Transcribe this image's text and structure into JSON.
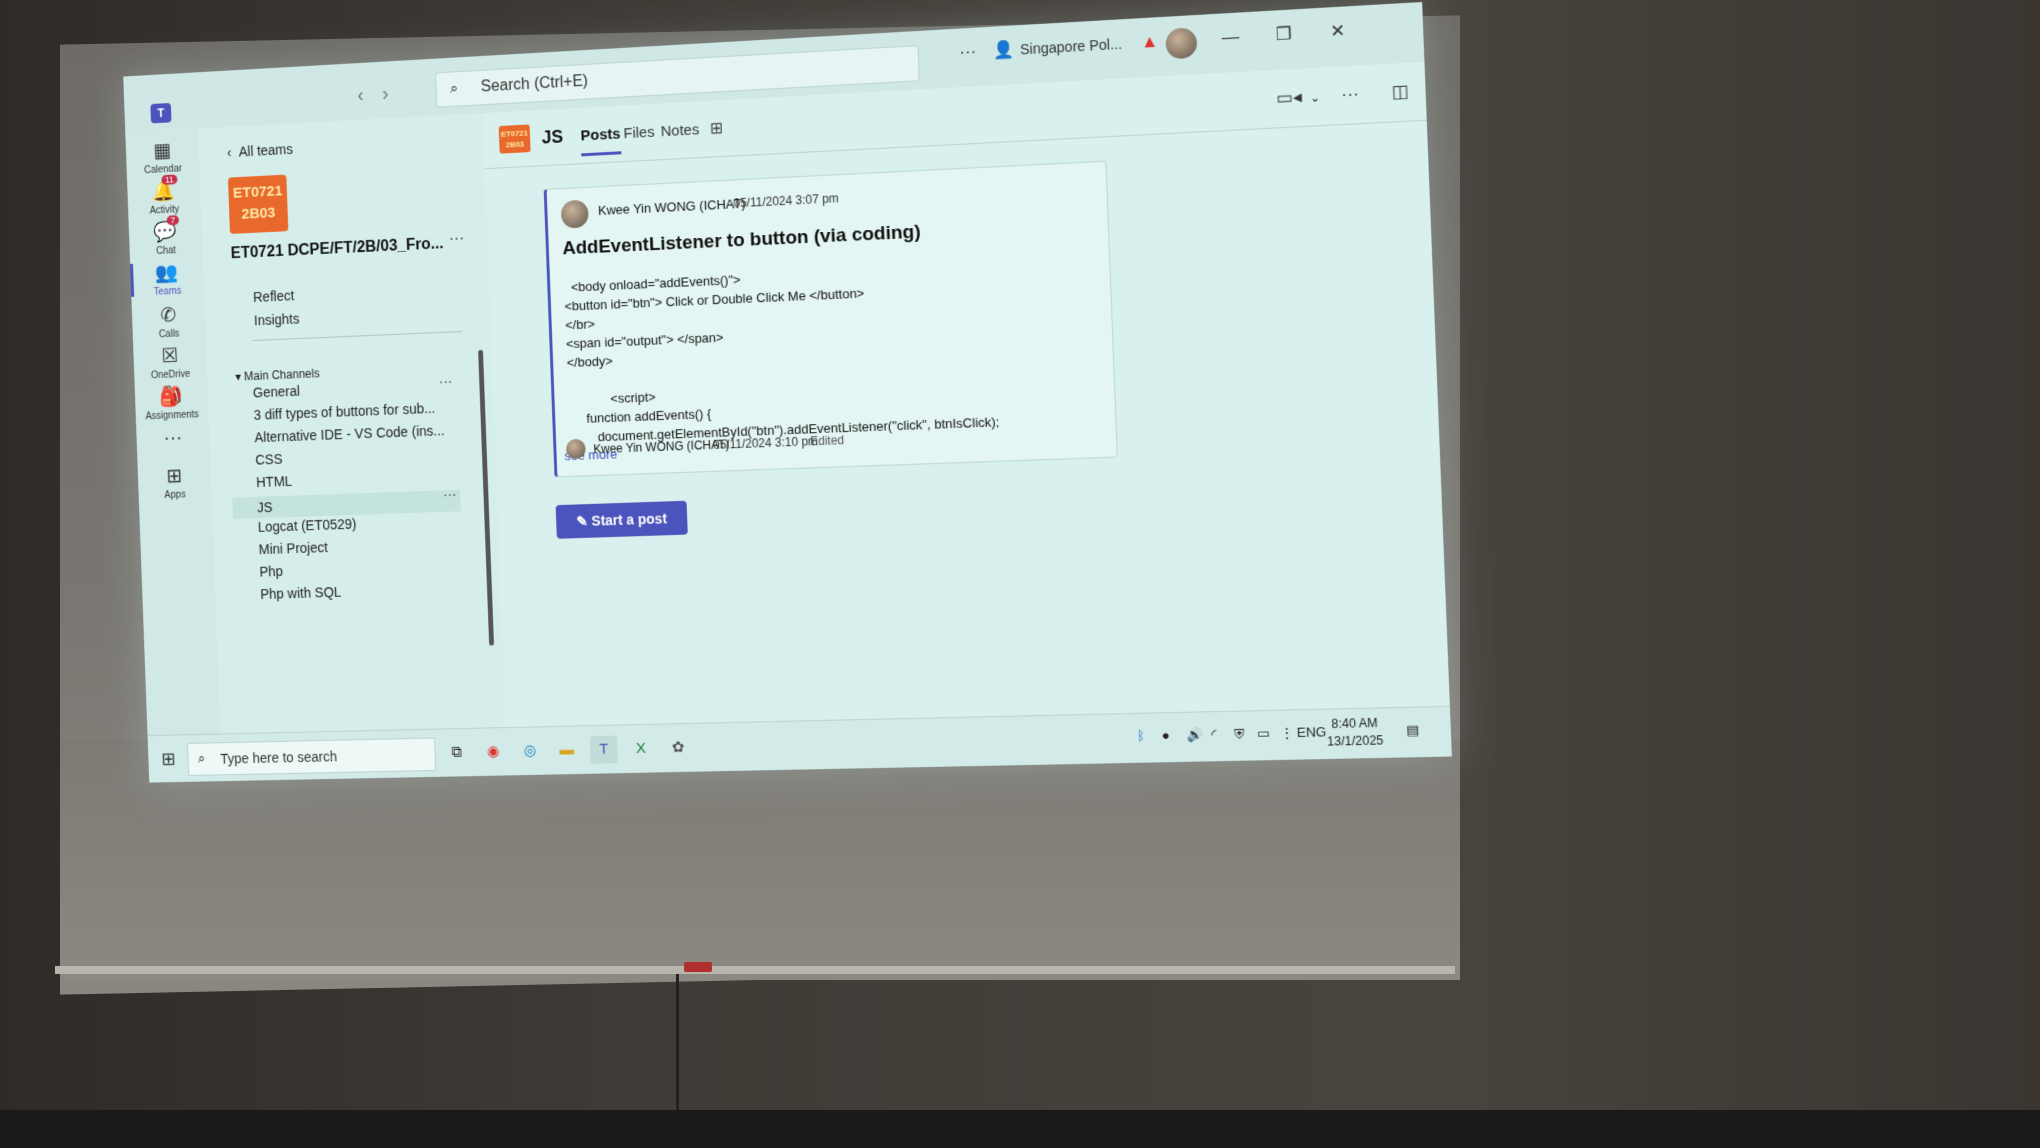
{
  "titlebar": {
    "search_placeholder": "Search (Ctrl+E)",
    "org_name": "Singapore Pol...",
    "more": "···"
  },
  "rail": [
    {
      "label": "Calendar",
      "icon": "calendar-icon",
      "glyph": "▦"
    },
    {
      "label": "Activity",
      "icon": "bell-icon",
      "glyph": "🔔",
      "badge": "11"
    },
    {
      "label": "Chat",
      "icon": "chat-icon",
      "glyph": "💬",
      "badge": "7"
    },
    {
      "label": "Teams",
      "icon": "teams-icon",
      "glyph": "👥",
      "active": true
    },
    {
      "label": "Calls",
      "icon": "phone-icon",
      "glyph": "✆"
    },
    {
      "label": "OneDrive",
      "icon": "onedrive-icon",
      "glyph": "☒"
    },
    {
      "label": "Assignments",
      "icon": "assignments-icon",
      "glyph": "🎒"
    },
    {
      "label": "",
      "icon": "more-icon",
      "glyph": "···"
    },
    {
      "label": "Apps",
      "icon": "apps-icon",
      "glyph": "⊞"
    }
  ],
  "team": {
    "back_label": "All teams",
    "logo_line1": "ET0721",
    "logo_line2": "2B03",
    "name": "ET0721 DCPE/FT/2B/03_Fro...",
    "links": [
      "Reflect",
      "Insights"
    ],
    "section_title": "Main Channels",
    "channels": [
      "General",
      "3 diff types of buttons for sub...",
      "Alternative IDE - VS Code (ins...",
      "CSS",
      "HTML",
      "JS",
      "Logcat (ET0529)",
      "Mini Project",
      "Php",
      "Php with SQL"
    ],
    "selected_channel": "JS"
  },
  "channel_header": {
    "logo_line1": "ET0721",
    "logo_line2": "2B03",
    "title": "JS",
    "tabs": [
      "Posts",
      "Files",
      "Notes"
    ],
    "active_tab": "Posts"
  },
  "post": {
    "author": "Kwee Yin WONG (ICHAT)",
    "time": "05/11/2024 3:07 pm",
    "subject": "AddEventListener to button (via coding)",
    "code_lines": [
      "  <body onload=\"addEvents()\">",
      "<button id=\"btn\"> Click or Double Click Me </button>",
      "</br>",
      "<span id=\"output\"> </span>",
      "</body>",
      "",
      "            <script>",
      "     function addEvents() {",
      "        document.getElementById(\"btn\").addEventListener(\"click\", btnIsClick);"
    ],
    "see_more": "see more"
  },
  "reply": {
    "author": "Kwee Yin WONG (ICHAT)",
    "time": "05/11/2024 3:10 pm",
    "edited": "Edited"
  },
  "start_post_label": "Start a post",
  "taskbar": {
    "search_placeholder": "Type here to search",
    "language": "ENG",
    "time": "8:40 AM",
    "date": "13/1/2025"
  },
  "colors": {
    "accent": "#4b53bc",
    "team_logo": "#e8692b",
    "badge": "#c4314b"
  }
}
